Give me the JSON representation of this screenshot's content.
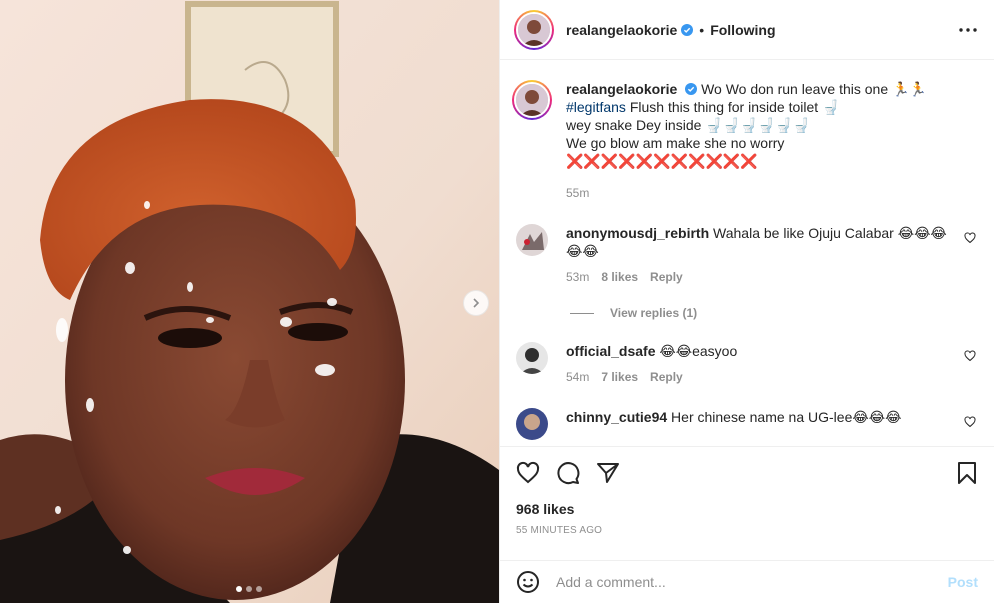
{
  "post": {
    "username": "realangelaokorie",
    "separator": "•",
    "follow_status": "Following",
    "likes": "968 likes",
    "timestamp": "55 MINUTES AGO"
  },
  "caption": {
    "username": "realangelaokorie",
    "line1": "Wo Wo don run leave this one 🏃🏃",
    "hashtag": "#legitfans",
    "line2": "Flush this thing for inside toilet 🚽",
    "line3": "wey snake Dey inside 🚽🚽🚽🚽🚽🚽",
    "line4": "We go blow am make she no worry",
    "line5": "❌❌❌❌❌❌❌❌❌❌❌",
    "time": "55m"
  },
  "comments": [
    {
      "username": "anonymousdj_rebirth",
      "text": "Wahala be like Ojuju Calabar 😂😂😂😂😂",
      "time": "53m",
      "likes": "8 likes",
      "reply": "Reply",
      "view_replies": "View replies (1)"
    },
    {
      "username": "official_dsafe",
      "text": "😂😂easyoo",
      "time": "54m",
      "likes": "7 likes",
      "reply": "Reply"
    },
    {
      "username": "chinny_cutie94",
      "text": "Her chinese name na UG-lee😂😂😂"
    }
  ],
  "add_comment": {
    "placeholder": "Add a comment...",
    "post_label": "Post"
  },
  "colors": {
    "verified": "#3897f0",
    "post_disabled": "#b2dffc",
    "muted": "#8e8e8e"
  }
}
